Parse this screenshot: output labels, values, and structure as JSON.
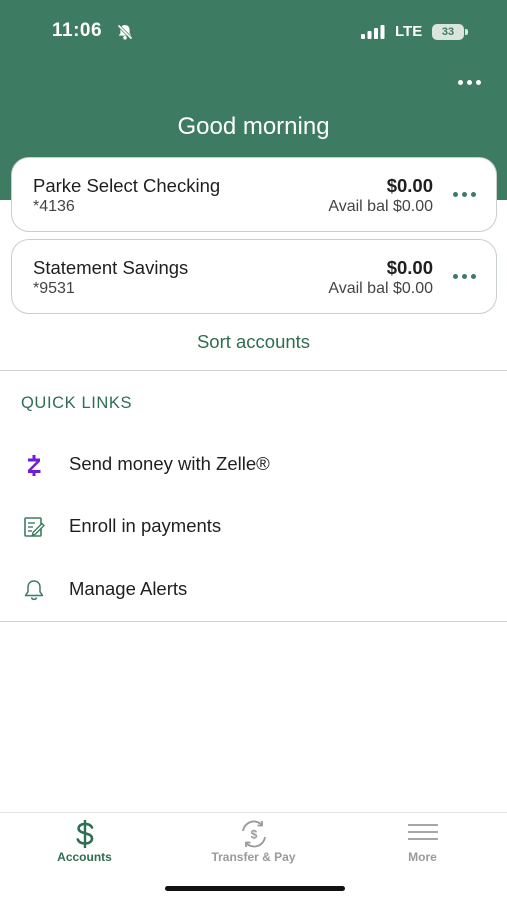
{
  "status_bar": {
    "time": "11:06",
    "network": "LTE",
    "battery": "33"
  },
  "header": {
    "greeting": "Good morning",
    "more_icon": "ellipsis-icon",
    "background_color": "#3d7c62"
  },
  "accounts": [
    {
      "name": "Parke Select Checking",
      "number": "*4136",
      "balance": "$0.00",
      "available": "Avail bal $0.00"
    },
    {
      "name": "Statement Savings",
      "number": "*9531",
      "balance": "$0.00",
      "available": "Avail bal $0.00"
    }
  ],
  "sort_accounts_label": "Sort accounts",
  "quick_links": {
    "heading": "QUICK LINKS",
    "items": [
      {
        "label": "Send money with Zelle®",
        "icon": "zelle-icon"
      },
      {
        "label": "Enroll in payments",
        "icon": "payment-form-icon"
      },
      {
        "label": "Manage Alerts",
        "icon": "bell-icon"
      }
    ]
  },
  "tab_bar": {
    "tabs": [
      {
        "label": "Accounts",
        "icon": "dollar-icon",
        "active": true
      },
      {
        "label": "Transfer & Pay",
        "icon": "transfer-icon",
        "active": false
      },
      {
        "label": "More",
        "icon": "menu-icon",
        "active": false
      }
    ],
    "active_color": "#2f6e52",
    "inactive_color": "#9a9a9a"
  },
  "colors": {
    "brand_green": "#3d7c62",
    "zelle_purple": "#6d1ed4"
  }
}
